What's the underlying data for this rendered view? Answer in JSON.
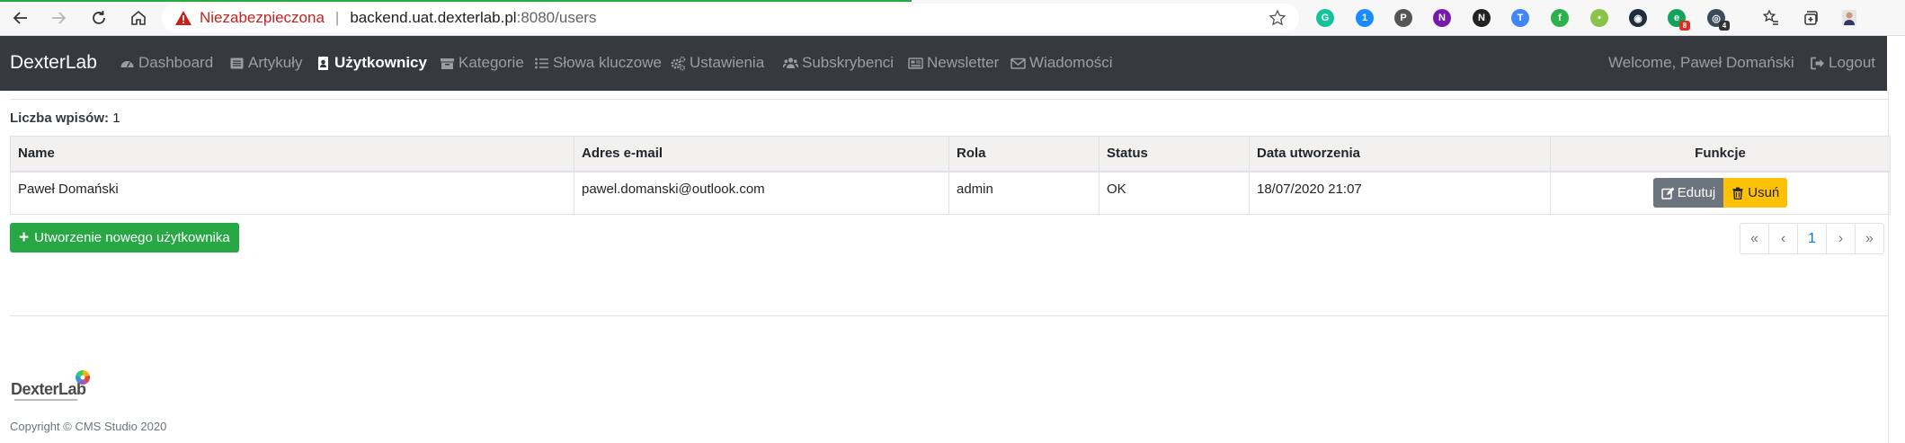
{
  "browser": {
    "security_label": "Niezabezpieczona",
    "url_host": "backend.uat.dexterlab.pl",
    "url_rest": ":8080/users",
    "extensions": [
      {
        "icon": "grammarly-icon",
        "color": "#15c39a",
        "letter": "G"
      },
      {
        "icon": "1password-icon",
        "color": "#1a8cff",
        "letter": "1"
      },
      {
        "icon": "pocket-icon",
        "color": "#555555",
        "letter": "P"
      },
      {
        "icon": "onenote-icon",
        "color": "#7719aa",
        "letter": "N"
      },
      {
        "icon": "notion-icon",
        "color": "#222222",
        "letter": "N"
      },
      {
        "icon": "translate-icon",
        "color": "#4285f4",
        "letter": "T"
      },
      {
        "icon": "feedly-icon",
        "color": "#2bb24c",
        "letter": "f"
      },
      {
        "icon": "extension-plant-icon",
        "color": "#8bc34a",
        "letter": "•"
      },
      {
        "icon": "extension-circle-icon",
        "color": "#1f2d3d",
        "letter": "◉"
      },
      {
        "icon": "extension-green-icon",
        "color": "#13a35a",
        "letter": "e",
        "badge": "8"
      },
      {
        "icon": "extension-globe-icon",
        "color": "#3a4b5c",
        "letter": "◎",
        "badge": "4"
      }
    ]
  },
  "navbar": {
    "brand": "DexterLab",
    "items": [
      {
        "label": "Dashboard",
        "icon": "dashboard-icon"
      },
      {
        "label": "Artykuły",
        "icon": "list-alt-icon"
      },
      {
        "label": "Użytkownicy",
        "icon": "user-card-icon"
      },
      {
        "label": "Kategorie",
        "icon": "archive-icon"
      },
      {
        "label": "Słowa kluczowe",
        "icon": "list-icon"
      },
      {
        "label": "Ustawienia",
        "icon": "cogs-icon"
      },
      {
        "label": "Subskrybenci",
        "icon": "users-icon"
      },
      {
        "label": "Newsletter",
        "icon": "newspaper-icon"
      },
      {
        "label": "Wiadomości",
        "icon": "envelope-icon"
      }
    ],
    "welcome": "Welcome, Paweł Domański",
    "logout": "Logout"
  },
  "main": {
    "count_label": "Liczba wpisów:",
    "count_value": "1",
    "table": {
      "headers": [
        "Name",
        "Adres e-mail",
        "Rola",
        "Status",
        "Data utworzenia",
        "Funkcje"
      ],
      "rows": [
        {
          "name": "Paweł Domański",
          "email": "pawel.domanski@outlook.com",
          "role": "admin",
          "status": "OK",
          "created": "18/07/2020 21:07"
        }
      ],
      "edit_label": "Edutuj",
      "delete_label": "Usuń"
    },
    "create_label": "Utworzenie nowego użytkownika",
    "pagination": [
      "«",
      "‹",
      "1",
      "›",
      "»"
    ]
  },
  "footer": {
    "logo_text": "DexterLab",
    "copyright": "Copyright © CMS Studio 2020"
  },
  "colors": {
    "navbar": "#343a40",
    "success": "#28a745",
    "warning": "#ffc107",
    "secondary": "#6c757d",
    "link": "#007bff",
    "danger": "#c5221f"
  }
}
